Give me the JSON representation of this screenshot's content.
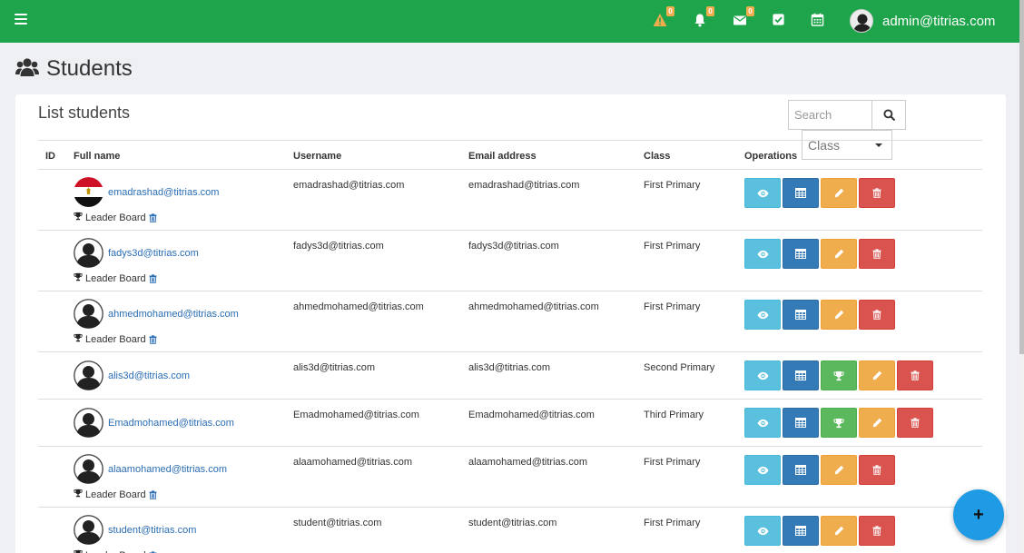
{
  "topbar": {
    "badges": {
      "warnings": "0",
      "notifications": "0",
      "messages": "0"
    },
    "user": "admin@titrias.com"
  },
  "page": {
    "title": "Students",
    "card_title": "List students"
  },
  "search": {
    "placeholder": "Search"
  },
  "class_filter": {
    "selected": "Class"
  },
  "table": {
    "headers": {
      "id": "ID",
      "fullname": "Full name",
      "username": "Username",
      "email": "Email address",
      "class": "Class",
      "operations": "Operations"
    },
    "leader_label": "Leader Board",
    "rows": [
      {
        "name": "emadrashad@titrias.com",
        "username": "emadrashad@titrias.com",
        "email": "emadrashad@titrias.com",
        "class": "First Primary",
        "avatar": "egypt-flag",
        "leader": true,
        "trophy": false
      },
      {
        "name": "fadys3d@titrias.com",
        "username": "fadys3d@titrias.com",
        "email": "fadys3d@titrias.com",
        "class": "First Primary",
        "avatar": "default",
        "leader": true,
        "trophy": false
      },
      {
        "name": "ahmedmohamed@titrias.com",
        "username": "ahmedmohamed@titrias.com",
        "email": "ahmedmohamed@titrias.com",
        "class": "First Primary",
        "avatar": "default",
        "leader": true,
        "trophy": false
      },
      {
        "name": "alis3d@titrias.com",
        "username": "alis3d@titrias.com",
        "email": "alis3d@titrias.com",
        "class": "Second Primary",
        "avatar": "default",
        "leader": false,
        "trophy": true
      },
      {
        "name": "Emadmohamed@titrias.com",
        "username": "Emadmohamed@titrias.com",
        "email": "Emadmohamed@titrias.com",
        "class": "Third Primary",
        "avatar": "default",
        "leader": false,
        "trophy": true
      },
      {
        "name": "alaamohamed@titrias.com",
        "username": "alaamohamed@titrias.com",
        "email": "alaamohamed@titrias.com",
        "class": "First Primary",
        "avatar": "default",
        "leader": true,
        "trophy": false
      },
      {
        "name": "student@titrias.com",
        "username": "student@titrias.com",
        "email": "student@titrias.com",
        "class": "First Primary",
        "avatar": "default",
        "leader": true,
        "trophy": false
      }
    ]
  },
  "fab": {
    "label": "+"
  },
  "colors": {
    "topbar": "#1ea54b",
    "link": "#2a6db4",
    "view": "#5bc0de",
    "grid": "#337ab7",
    "trophy": "#5cb85c",
    "edit": "#f0ad4e",
    "delete": "#d9534f",
    "fab": "#1e9be4"
  }
}
